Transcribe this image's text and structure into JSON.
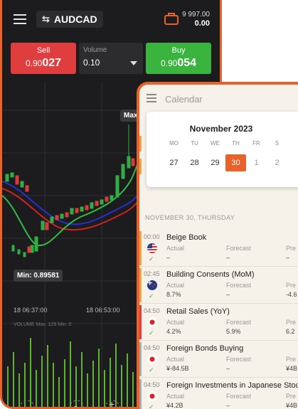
{
  "trading": {
    "pair": "AUDCAD",
    "balance_line1": "9 997.00",
    "balance_line2": "0.00",
    "sell_label": "Sell",
    "sell_price_prefix": "0.90",
    "sell_price_big": "027",
    "volume_label": "Volume",
    "volume_value": "0.10",
    "buy_label": "Buy",
    "buy_price_prefix": "0.90",
    "buy_price_big": "054",
    "max_tag": "Max",
    "min_tag": "Min: 0.89581",
    "time_labels": [
      "18 06:37:00",
      "18 06:53:00"
    ],
    "volume_caption": "VOLUME  Max: 129 Min: 0",
    "bottom_controls": [
      "-",
      "+"
    ],
    "colors": {
      "accent": "#e8622a",
      "sell": "#e03e3e",
      "buy": "#3bb33f",
      "bg": "#1c1c1e"
    }
  },
  "calendar": {
    "title": "Calendar",
    "month": "November 2023",
    "weekdays": [
      "MO",
      "TU",
      "WE",
      "TH",
      "FR",
      "S"
    ],
    "days": [
      "27",
      "28",
      "29",
      "30",
      "1",
      "2"
    ],
    "selected_day": "30",
    "date_header": "NOVEMBER 30, THURSDAY",
    "events": [
      {
        "time": "00:00",
        "name": "Beige Book",
        "flag": "us-flag",
        "col1_h": "Actual",
        "col1_v": "–",
        "col2_h": "Forecast",
        "col2_v": "–",
        "col3_h": "Pre",
        "col3_v": "–",
        "col1_tone": "",
        "col3_tone": "",
        "bar_color": "#e8a64a"
      },
      {
        "time": "02:45",
        "name": "Building Consents (MoM)",
        "flag": "nz-flag",
        "col1_h": "Actual",
        "col1_v": "8.7%",
        "col2_h": "Forecast",
        "col2_v": "–",
        "col3_h": "Pre",
        "col3_v": "-4.6",
        "col1_tone": "pos",
        "col3_tone": "",
        "bar_color": "#e8a64a"
      },
      {
        "time": "04:50",
        "name": "Retail Sales (YoY)",
        "flag": "jp-flag",
        "col1_h": "Actual",
        "col1_v": "4.2%",
        "col2_h": "Forecast",
        "col2_v": "5.9%",
        "col3_h": "Pre",
        "col3_v": "6.2",
        "col1_tone": "neg",
        "col3_tone": "",
        "bar_color": "#e03e3e"
      },
      {
        "time": "04:50",
        "name": "Foreign Bonds Buying",
        "flag": "jp-flag",
        "col1_h": "Actual",
        "col1_v": "¥-84.5B",
        "col2_h": "Forecast",
        "col2_v": "–",
        "col3_h": "Pre",
        "col3_v": "¥4B",
        "col1_tone": "neg",
        "col3_tone": "",
        "bar_color": "#aaaaaa"
      },
      {
        "time": "04:50",
        "name": "Foreign Investments in Japanese Stocks",
        "flag": "jp-flag",
        "col1_h": "Actual",
        "col1_v": "¥4.2B",
        "col2_h": "Forecast",
        "col2_v": "–",
        "col3_h": "Pre",
        "col3_v": "¥4B",
        "col1_tone": "neg",
        "col3_tone": "",
        "bar_color": "#aaaaaa"
      }
    ]
  }
}
